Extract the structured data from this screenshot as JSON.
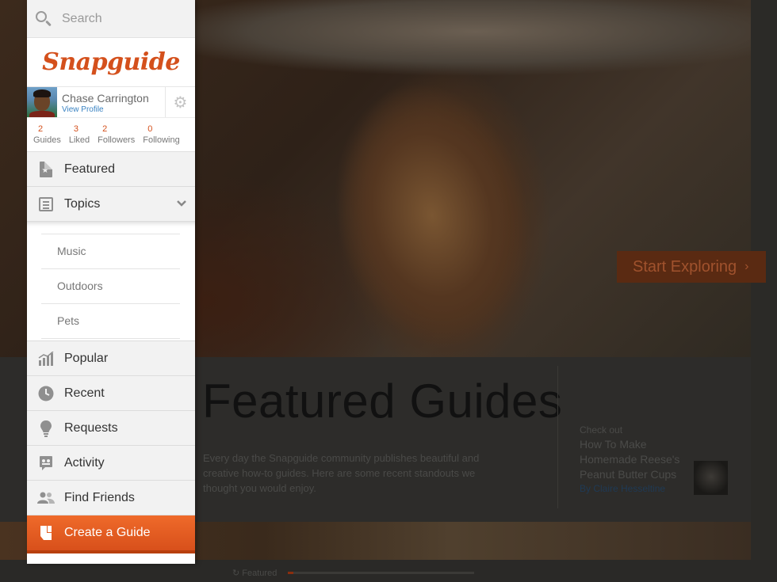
{
  "sidebar": {
    "search_placeholder": "Search",
    "logo_text": "Snapguide",
    "profile": {
      "name": "Chase Carrington",
      "link": "View Profile"
    },
    "stats": [
      {
        "num": "2",
        "label": "Guides"
      },
      {
        "num": "3",
        "label": "Liked"
      },
      {
        "num": "2",
        "label": "Followers"
      },
      {
        "num": "0",
        "label": "Following"
      }
    ],
    "nav": {
      "featured": "Featured",
      "topics": "Topics",
      "popular": "Popular",
      "recent": "Recent",
      "requests": "Requests",
      "activity": "Activity",
      "find_friends": "Find Friends",
      "create_guide": "Create a Guide"
    },
    "topics_list": [
      "Music",
      "Outdoors",
      "Pets"
    ]
  },
  "main": {
    "start_exploring": "Start Exploring",
    "featured_title": "Featured Guides",
    "featured_desc": "Every day the Snapguide community publishes beautiful and creative how-to guides. Here are some recent standouts we thought you would enjoy.",
    "checkout": {
      "label": "Check out",
      "title": "How To Make Homemade Reese's Peanut Butter Cups",
      "author": "By Claire Hesseltine"
    },
    "bottom": {
      "indicator_label": "Featured",
      "progress": 0.03
    }
  },
  "colors": {
    "accent": "#d4501c",
    "link": "#3a83c2"
  }
}
